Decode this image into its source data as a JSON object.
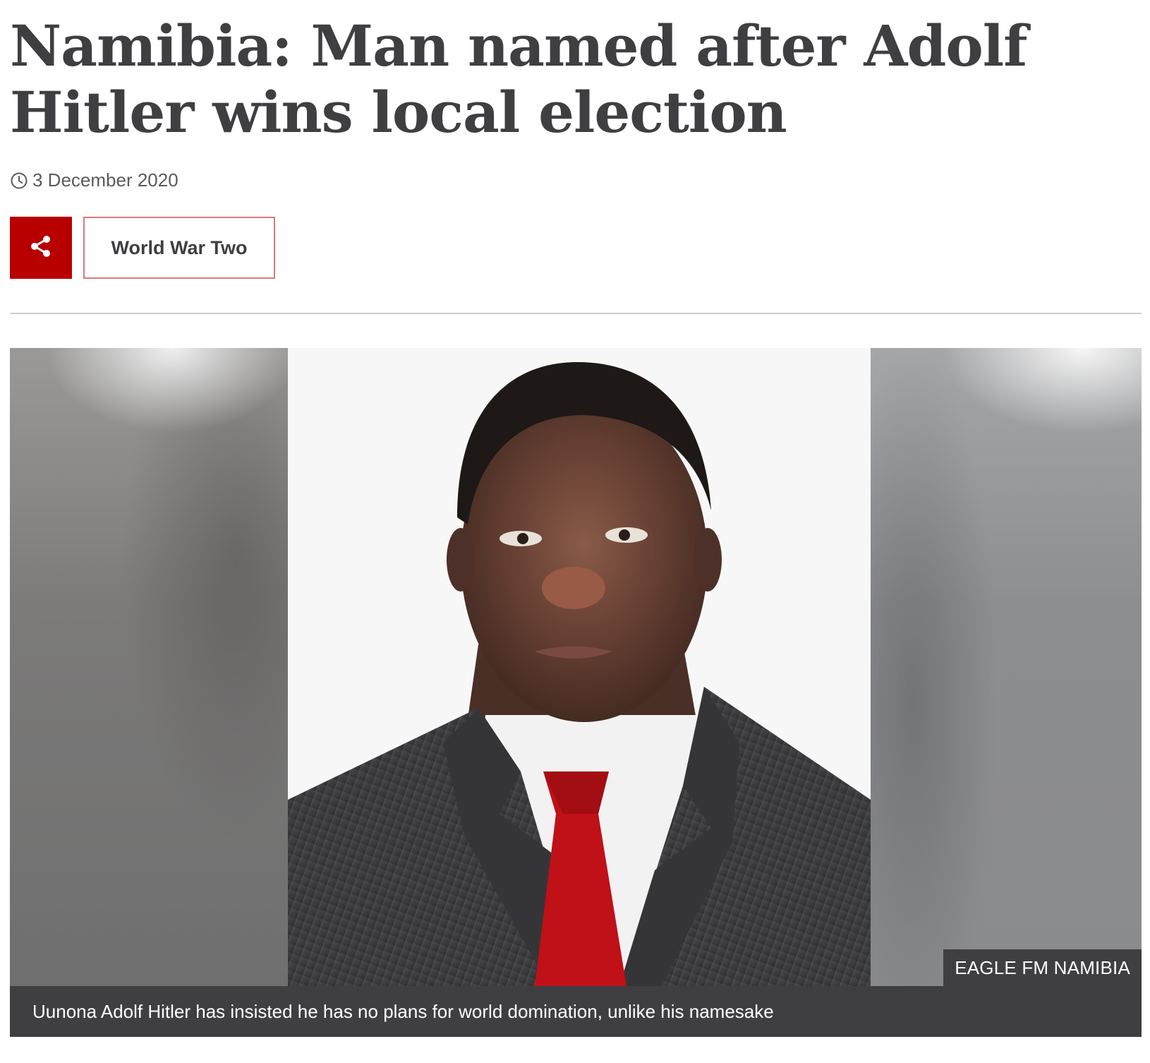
{
  "article": {
    "headline": "Namibia: Man named after Adolf Hitler wins local election",
    "date": "3 December 2020",
    "date_icon": "clock-icon",
    "share_icon": "share-icon",
    "topic_label": "World War Two"
  },
  "image": {
    "credit": "EAGLE FM NAMIBIA",
    "caption": "Uunona Adolf Hitler has insisted he has no plans for world domination, unlike his namesake"
  },
  "colors": {
    "accent": "#b80000",
    "topic_border": "#d87a7a",
    "text": "#3f3f42",
    "caption_bg": "#3f3f42",
    "divider": "#cfcfcf"
  }
}
